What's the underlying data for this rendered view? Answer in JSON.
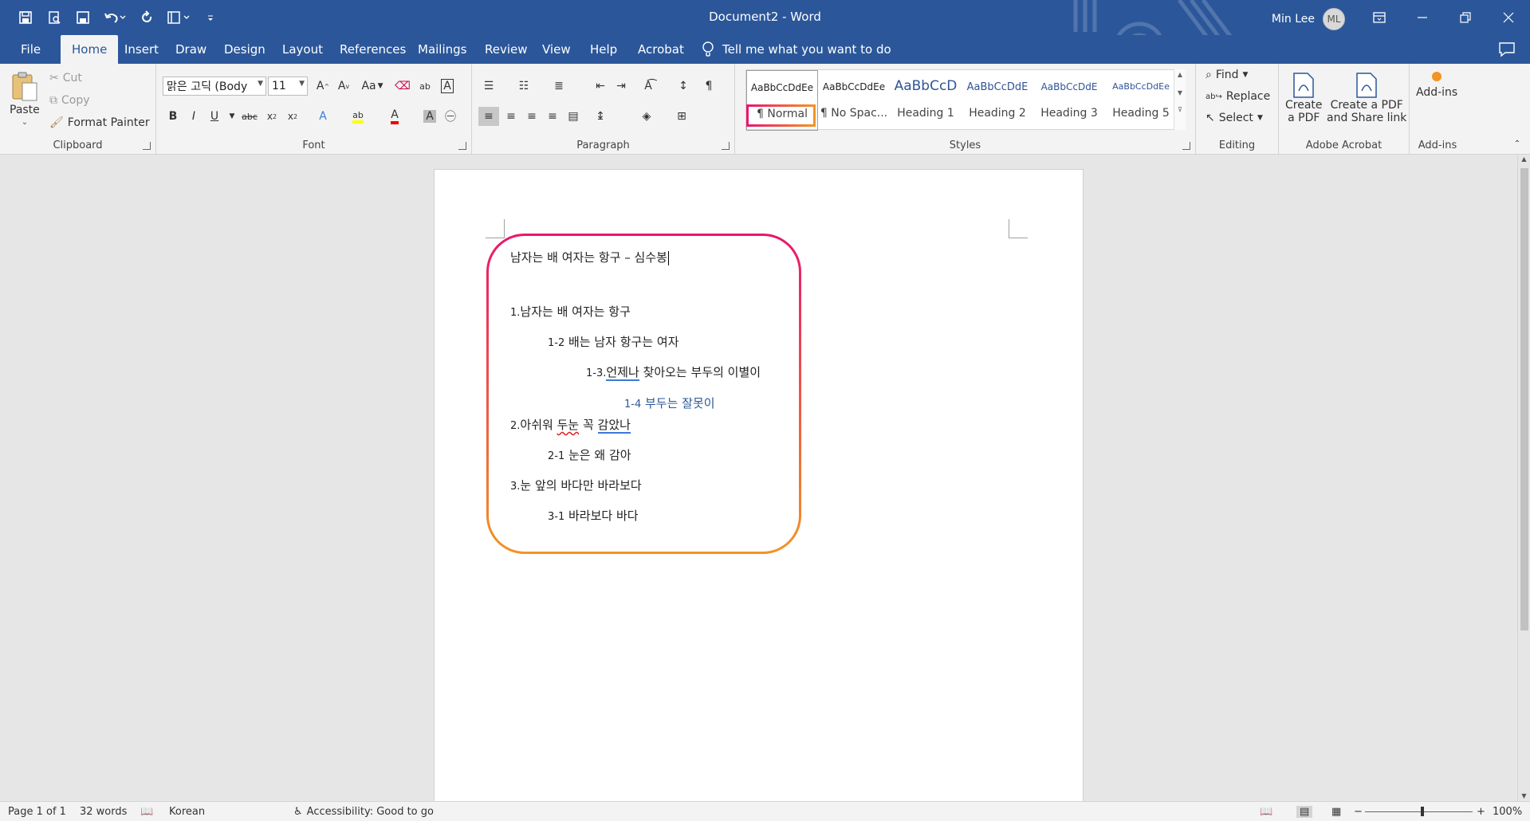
{
  "titlebar": {
    "doc_title": "Document2  -  Word",
    "user_name": "Min Lee",
    "avatar_initials": "ML",
    "qat_icons": [
      "save-icon",
      "print-preview-icon",
      "save-as-icon",
      "undo-icon",
      "redo-icon",
      "layout-icon",
      "customize-icon"
    ],
    "window_controls": [
      "ribbon-display-options-icon",
      "minimize-icon",
      "restore-icon",
      "close-icon"
    ]
  },
  "tabs": [
    {
      "label": "File"
    },
    {
      "label": "Home"
    },
    {
      "label": "Insert"
    },
    {
      "label": "Draw"
    },
    {
      "label": "Design"
    },
    {
      "label": "Layout"
    },
    {
      "label": "References"
    },
    {
      "label": "Mailings"
    },
    {
      "label": "Review"
    },
    {
      "label": "View"
    },
    {
      "label": "Help"
    },
    {
      "label": "Acrobat"
    }
  ],
  "tell_me": "Tell me what you want to do",
  "clipboard": {
    "paste": "Paste",
    "cut": "Cut",
    "copy": "Copy",
    "format_painter": "Format Painter",
    "group_label": "Clipboard"
  },
  "font": {
    "family": "맑은 고딕 (Body",
    "size": "11",
    "group_label": "Font",
    "change_case": "Aa"
  },
  "paragraph": {
    "group_label": "Paragraph"
  },
  "styles": {
    "group_label": "Styles",
    "items": [
      {
        "preview": "AaBbCcDdEe",
        "name": "¶ Normal"
      },
      {
        "preview": "AaBbCcDdEe",
        "name": "¶ No Spac..."
      },
      {
        "preview": "AaBbCcD",
        "name": "Heading 1"
      },
      {
        "preview": "AaBbCcDdE",
        "name": "Heading 2"
      },
      {
        "preview": "AaBbCcDdE",
        "name": "Heading 3"
      },
      {
        "preview": "AaBbCcDdEe",
        "name": "Heading 5"
      }
    ]
  },
  "editing": {
    "find": "Find",
    "replace": "Replace",
    "select": "Select",
    "group_label": "Editing"
  },
  "acrobat": {
    "create_pdf_line1": "Create",
    "create_pdf_line2": "a PDF",
    "share_line1": "Create a PDF",
    "share_line2": "and Share link",
    "group_label": "Adobe Acrobat"
  },
  "addins": {
    "label": "Add-ins",
    "group_label": "Add-ins"
  },
  "document": {
    "title": "남자는 배 여자는 항구 – 심수봉",
    "l1_num": "1.",
    "l1_text": "남자는 배 여자는 항구",
    "l2_num": "1-2",
    "l2_text": " 배는 남자 항구는 여자",
    "l3_num": "1-3.",
    "l3_u": "언제나",
    "l3_text": " 찾아오는 부두의 이별이",
    "l4_num": "1-4",
    "l4_text": " 부두는 잘못이",
    "l5_num": "2.",
    "l5_a": "아쉬워 ",
    "l5_squig": "두눈",
    "l5_b": " 꼭 ",
    "l5_u": "감았나",
    "l6_num": "2-1",
    "l6_text": " 눈은 왜 감아",
    "l7_num": "3.",
    "l7_text": "눈 앞의 바다만 바라보다",
    "l8_num": "3-1",
    "l8_text": " 바라보다 바다"
  },
  "statusbar": {
    "page": "Page 1 of 1",
    "words": "32 words",
    "language": "Korean",
    "accessibility": "Accessibility: Good to go",
    "zoom_minus": "−",
    "zoom_plus": "+",
    "zoom": "100%"
  }
}
